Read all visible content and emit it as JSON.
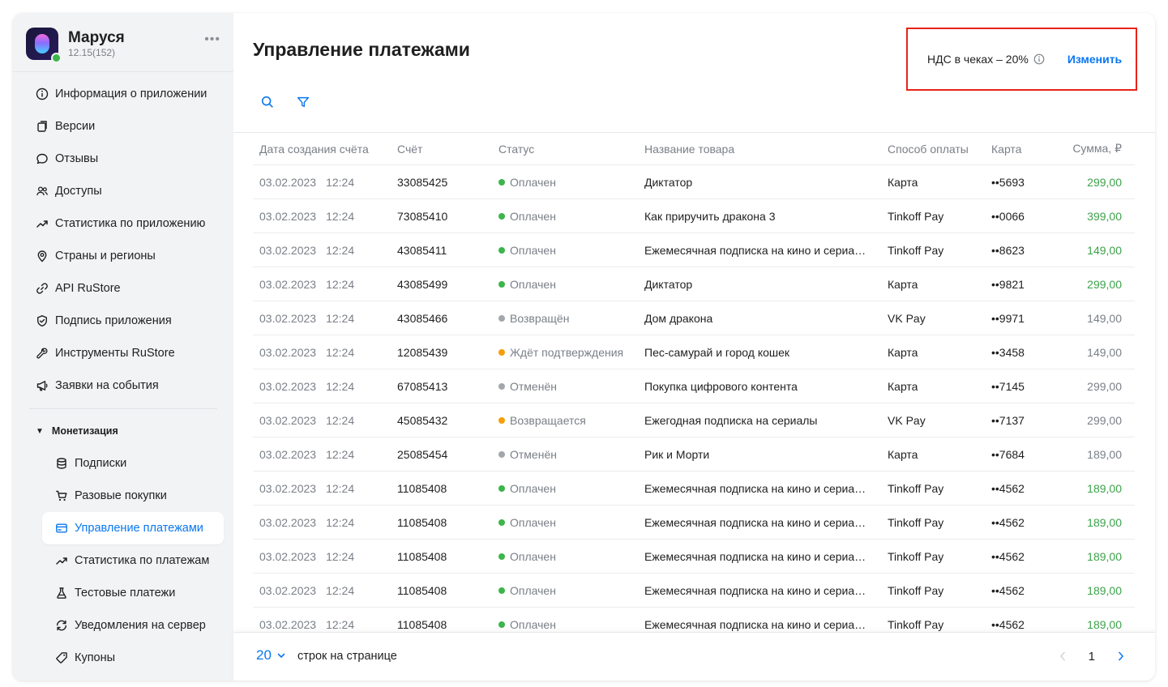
{
  "app": {
    "name": "Маруся",
    "version": "12.15(152)",
    "more_label": "•••"
  },
  "nav": [
    {
      "label": "Информация о приложении",
      "icon": "info-icon"
    },
    {
      "label": "Версии",
      "icon": "versions-icon"
    },
    {
      "label": "Отзывы",
      "icon": "chat-bubble-icon"
    },
    {
      "label": "Доступы",
      "icon": "users-icon"
    },
    {
      "label": "Статистика по приложению",
      "icon": "trend-icon"
    },
    {
      "label": "Страны и регионы",
      "icon": "location-pin-icon"
    },
    {
      "label": "API RuStore",
      "icon": "link-icon"
    },
    {
      "label": "Подпись приложения",
      "icon": "shield-check-icon"
    },
    {
      "label": "Инструменты RuStore",
      "icon": "wrench-icon"
    },
    {
      "label": "Заявки на события",
      "icon": "megaphone-icon"
    }
  ],
  "monetization": {
    "caret": "▼",
    "title": "Монетизация",
    "items": [
      {
        "label": "Подписки",
        "icon": "database-icon",
        "active": false
      },
      {
        "label": "Разовые покупки",
        "icon": "cart-icon",
        "active": false
      },
      {
        "label": "Управление платежами",
        "icon": "credit-card-icon",
        "active": true
      },
      {
        "label": "Статистика по платежам",
        "icon": "trend-icon",
        "active": false
      },
      {
        "label": "Тестовые платежи",
        "icon": "flask-icon",
        "active": false
      },
      {
        "label": "Уведомления на сервер",
        "icon": "server-sync-icon",
        "active": false
      },
      {
        "label": "Купоны",
        "icon": "tag-icon",
        "active": false
      }
    ]
  },
  "page": {
    "title": "Управление платежами",
    "vat_text": "НДС в чеках – 20%",
    "vat_change": "Изменить"
  },
  "table": {
    "headers": {
      "date": "Дата создания счёта",
      "account": "Счёт",
      "status": "Статус",
      "name": "Название товара",
      "payment": "Способ оплаты",
      "card": "Карта",
      "sum": "Сумма, ₽"
    },
    "rows": [
      {
        "date": "03.02.2023",
        "time": "12:24",
        "account": "33085425",
        "status": "Оплачен",
        "status_color": "#3cb54a",
        "name": "Диктатор",
        "payment": "Карта",
        "card": "••5693",
        "sum": "299,00",
        "paid": true
      },
      {
        "date": "03.02.2023",
        "time": "12:24",
        "account": "73085410",
        "status": "Оплачен",
        "status_color": "#3cb54a",
        "name": "Как приручить дракона 3",
        "payment": "Tinkoff Pay",
        "card": "••0066",
        "sum": "399,00",
        "paid": true
      },
      {
        "date": "03.02.2023",
        "time": "12:24",
        "account": "43085411",
        "status": "Оплачен",
        "status_color": "#3cb54a",
        "name": "Ежемесячная подписка на кино и сериа…",
        "payment": "Tinkoff Pay",
        "card": "••8623",
        "sum": "149,00",
        "paid": true
      },
      {
        "date": "03.02.2023",
        "time": "12:24",
        "account": "43085499",
        "status": "Оплачен",
        "status_color": "#3cb54a",
        "name": "Диктатор",
        "payment": "Карта",
        "card": "••9821",
        "sum": "299,00",
        "paid": true
      },
      {
        "date": "03.02.2023",
        "time": "12:24",
        "account": "43085466",
        "status": "Возвращён",
        "status_color": "#a3a7ad",
        "name": "Дом дракона",
        "payment": "VK Pay",
        "card": "••9971",
        "sum": "149,00",
        "paid": false
      },
      {
        "date": "03.02.2023",
        "time": "12:24",
        "account": "12085439",
        "status": "Ждёт подтверждения",
        "status_color": "#f59e0b",
        "name": "Пес-самурай и город кошек",
        "payment": "Карта",
        "card": "••3458",
        "sum": "149,00",
        "paid": false
      },
      {
        "date": "03.02.2023",
        "time": "12:24",
        "account": "67085413",
        "status": "Отменён",
        "status_color": "#a3a7ad",
        "name": "Покупка цифрового контента",
        "payment": "Карта",
        "card": "••7145",
        "sum": "299,00",
        "paid": false
      },
      {
        "date": "03.02.2023",
        "time": "12:24",
        "account": "45085432",
        "status": "Возвращается",
        "status_color": "#f59e0b",
        "name": "Ежегодная подписка на сериалы",
        "payment": "VK Pay",
        "card": "••7137",
        "sum": "299,00",
        "paid": false
      },
      {
        "date": "03.02.2023",
        "time": "12:24",
        "account": "25085454",
        "status": "Отменён",
        "status_color": "#a3a7ad",
        "name": "Рик и Морти",
        "payment": "Карта",
        "card": "••7684",
        "sum": "189,00",
        "paid": false
      },
      {
        "date": "03.02.2023",
        "time": "12:24",
        "account": "11085408",
        "status": "Оплачен",
        "status_color": "#3cb54a",
        "name": "Ежемесячная подписка на кино и сериа…",
        "payment": "Tinkoff Pay",
        "card": "••4562",
        "sum": "189,00",
        "paid": true
      },
      {
        "date": "03.02.2023",
        "time": "12:24",
        "account": "11085408",
        "status": "Оплачен",
        "status_color": "#3cb54a",
        "name": "Ежемесячная подписка на кино и сериа…",
        "payment": "Tinkoff Pay",
        "card": "••4562",
        "sum": "189,00",
        "paid": true
      },
      {
        "date": "03.02.2023",
        "time": "12:24",
        "account": "11085408",
        "status": "Оплачен",
        "status_color": "#3cb54a",
        "name": "Ежемесячная подписка на кино и сериа…",
        "payment": "Tinkoff Pay",
        "card": "••4562",
        "sum": "189,00",
        "paid": true
      },
      {
        "date": "03.02.2023",
        "time": "12:24",
        "account": "11085408",
        "status": "Оплачен",
        "status_color": "#3cb54a",
        "name": "Ежемесячная подписка на кино и сериа…",
        "payment": "Tinkoff Pay",
        "card": "••4562",
        "sum": "189,00",
        "paid": true
      },
      {
        "date": "03.02.2023",
        "time": "12:24",
        "account": "11085408",
        "status": "Оплачен",
        "status_color": "#3cb54a",
        "name": "Ежемесячная подписка на кино и сериа…",
        "payment": "Tinkoff Pay",
        "card": "••4562",
        "sum": "189,00",
        "paid": true
      }
    ]
  },
  "footer": {
    "rows_per_page": "20",
    "rows_label": "строк на странице",
    "current_page": "1"
  },
  "colors": {
    "accent": "#0a77ee",
    "paid_sum": "#3ca24a",
    "highlight_border": "#e8231a",
    "online": "#3cb54a"
  }
}
